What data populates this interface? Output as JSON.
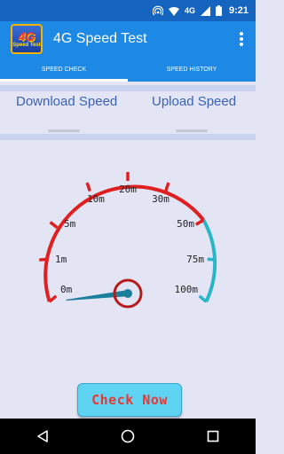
{
  "status_bar": {
    "network": "4G",
    "time": "9:21"
  },
  "app": {
    "title": "4G Speed Test",
    "logo_big": "4G",
    "logo_small": "Speed Test"
  },
  "tabs": [
    {
      "label": "SPEED CHECK",
      "active": true
    },
    {
      "label": "SPEED HISTORY",
      "active": false
    }
  ],
  "speeds": {
    "download_label": "Download Speed",
    "upload_label": "Upload Speed"
  },
  "gauge": {
    "ticks": [
      "0m",
      "1m",
      "5m",
      "10m",
      "20m",
      "30m",
      "50m",
      "75m",
      "100m"
    ],
    "needle_value": "0m",
    "colors": {
      "arc_main": "#e02020",
      "arc_end": "#29b6c8",
      "needle": "#1a7f9b"
    }
  },
  "action": {
    "check_label": "Check Now"
  },
  "icons": {
    "back": "back-icon",
    "home": "home-icon",
    "recents": "recents-icon",
    "menu": "overflow-menu-icon"
  }
}
